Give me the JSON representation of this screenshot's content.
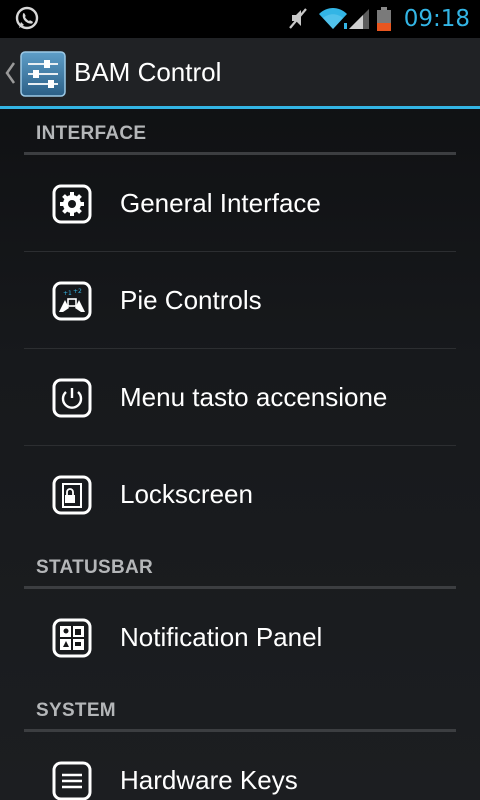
{
  "status_bar": {
    "time": "09:18",
    "icons": [
      "whatsapp-notification-icon",
      "mute-icon",
      "wifi-icon",
      "signal-icon",
      "battery-icon"
    ],
    "accent_color": "#33b5e5",
    "battery_color": "#e8561f"
  },
  "action_bar": {
    "title": "BAM Control",
    "icon": "sliders-icon",
    "divider_color": "#33b5e5"
  },
  "sections": [
    {
      "header": "INTERFACE",
      "items": [
        {
          "label": "General Interface",
          "icon": "gear-icon"
        },
        {
          "label": "Pie Controls",
          "icon": "pie-controls-icon"
        },
        {
          "label": "Menu tasto accensione",
          "icon": "power-icon"
        },
        {
          "label": "Lockscreen",
          "icon": "lockscreen-icon"
        }
      ]
    },
    {
      "header": "STATUSBAR",
      "items": [
        {
          "label": "Notification Panel",
          "icon": "notification-panel-icon"
        }
      ]
    },
    {
      "header": "SYSTEM",
      "items": [
        {
          "label": "Hardware Keys",
          "icon": "hardware-keys-icon"
        }
      ]
    }
  ]
}
